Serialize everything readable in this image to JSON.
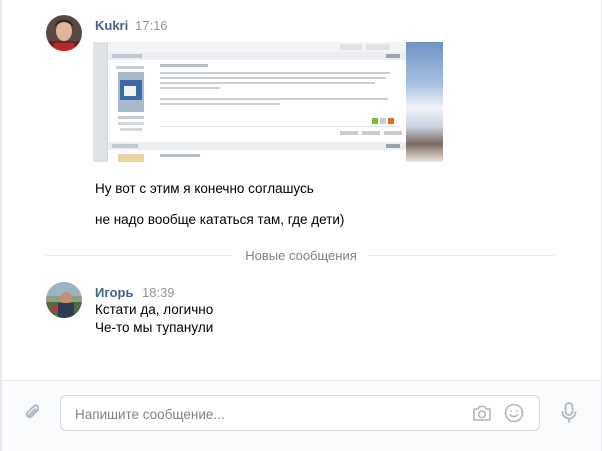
{
  "messages": [
    {
      "author": "Kukri",
      "time": "17:16",
      "lines": [
        "Ну вот с этим я конечно соглашусь",
        "не надо вообще кататься там, где дети)"
      ]
    },
    {
      "author": "Игорь",
      "time": "18:39",
      "lines": [
        "Кстати да, логично",
        "Че-то мы тупанули"
      ]
    }
  ],
  "divider": {
    "label": "Новые сообщения"
  },
  "composer": {
    "placeholder": "Напишите сообщение..."
  },
  "icons": {
    "attach": "paperclip-icon",
    "camera": "camera-icon",
    "emoji": "smile-icon",
    "voice": "microphone-icon"
  },
  "colors": {
    "author": "#42648b",
    "time": "#939393",
    "divider_text": "#828282",
    "icon": "#aeb7c2"
  }
}
